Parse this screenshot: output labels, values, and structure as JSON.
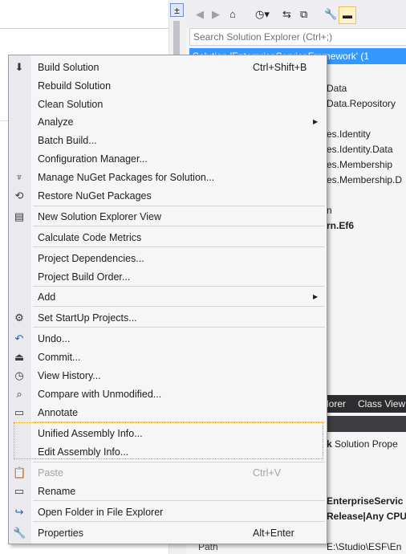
{
  "toolbar": {
    "back_icon": "back-arrow-icon",
    "forward_icon": "forward-arrow-icon",
    "home_icon": "home-icon",
    "history_icon": "clock-icon",
    "sync_icon": "sync-icon",
    "collapse_icon": "collapse-all-icon",
    "properties_icon": "wrench-icon",
    "preview_icon": "preview-icon"
  },
  "search": {
    "placeholder": "Search Solution Explorer (Ctrl+;)"
  },
  "solution_explorer": {
    "selected_item": "Solution 'EnterpriseServiceFramework' (1",
    "items": [
      "Data",
      "Data.Repository",
      "es.Identity",
      "es.Identity.Data",
      "es.Membership",
      "es.Membership.D",
      "n",
      "rn.Ef6"
    ]
  },
  "tabs": [
    "lorer",
    "Class View"
  ],
  "properties": {
    "title_bold": "k",
    "title": "Solution Prope",
    "name_value": "EnterpriseServic",
    "config_value": "Release|Any CPU",
    "path_label": "Path",
    "path_value": "E:\\Studio\\ESF\\En"
  },
  "menu": {
    "items": [
      {
        "label": "Build Solution",
        "shortcut": "Ctrl+Shift+B",
        "icon": "build-solution-icon"
      },
      {
        "label": "Rebuild Solution"
      },
      {
        "label": "Clean Solution"
      },
      {
        "label": "Analyze",
        "submenu": true
      },
      {
        "label": "Batch Build..."
      },
      {
        "label": "Configuration Manager..."
      },
      {
        "label": "Manage NuGet Packages for Solution...",
        "icon": "nuget-icon"
      },
      {
        "label": "Restore NuGet Packages",
        "icon": "restore-packages-icon"
      },
      {
        "label": "New Solution Explorer View",
        "icon": "new-view-icon"
      },
      {
        "label": "Calculate Code Metrics"
      },
      {
        "label": "Project Dependencies..."
      },
      {
        "label": "Project Build Order..."
      },
      {
        "label": "Add",
        "submenu": true
      },
      {
        "label": "Set StartUp Projects...",
        "icon": "gear-icon"
      },
      {
        "label": "Undo...",
        "icon": "undo-icon"
      },
      {
        "label": "Commit...",
        "icon": "commit-icon"
      },
      {
        "label": "View History...",
        "icon": "history-icon"
      },
      {
        "label": "Compare with Unmodified...",
        "icon": "compare-icon"
      },
      {
        "label": "Annotate",
        "icon": "annotate-icon"
      },
      {
        "label": "Unified Assembly Info..."
      },
      {
        "label": "Edit Assembly Info..."
      },
      {
        "label": "Paste",
        "shortcut": "Ctrl+V",
        "disabled": true,
        "icon": "paste-icon"
      },
      {
        "label": "Rename",
        "icon": "rename-icon"
      },
      {
        "label": "Open Folder in File Explorer",
        "icon": "open-folder-icon"
      },
      {
        "label": "Properties",
        "shortcut": "Alt+Enter",
        "icon": "wrench-icon"
      }
    ]
  }
}
